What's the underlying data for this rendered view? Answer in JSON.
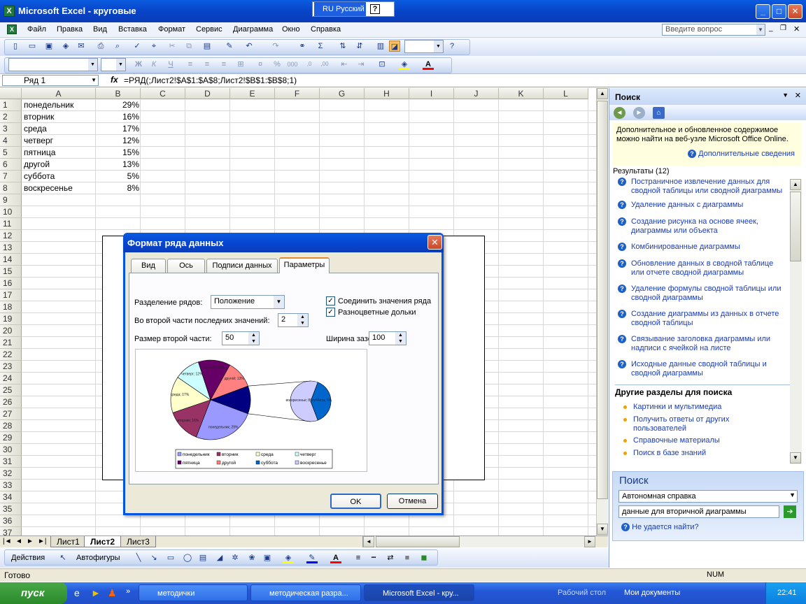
{
  "window": {
    "title": "Microsoft Excel - круговые",
    "lang": "RU Русский",
    "help_glyph": "?"
  },
  "menu": [
    "Файл",
    "Правка",
    "Вид",
    "Вставка",
    "Формат",
    "Сервис",
    "Диаграмма",
    "Окно",
    "Справка"
  ],
  "ask_placeholder": "Введите вопрос",
  "formula_bar": {
    "name_box": "Ряд 1",
    "fx": "fx",
    "formula": "=РЯД(;Лист2!$A$1:$A$8;Лист2!$B$1:$B$8;1)"
  },
  "columns": [
    "A",
    "B",
    "C",
    "D",
    "E",
    "F",
    "G",
    "H",
    "I",
    "J",
    "K",
    "L"
  ],
  "rows": [
    "1",
    "2",
    "3",
    "4",
    "5",
    "6",
    "7",
    "8",
    "9",
    "10",
    "11",
    "12",
    "13",
    "14",
    "15",
    "16",
    "17",
    "18",
    "19",
    "20",
    "21",
    "22",
    "23",
    "24",
    "25",
    "26",
    "27",
    "28",
    "29",
    "30",
    "31",
    "32",
    "33",
    "34",
    "35",
    "36",
    "37"
  ],
  "cells": [
    {
      "a": "понедельник",
      "b": "29%"
    },
    {
      "a": "вторник",
      "b": "16%"
    },
    {
      "a": "среда",
      "b": "17%"
    },
    {
      "a": "четверг",
      "b": "12%"
    },
    {
      "a": "пятница",
      "b": "15%"
    },
    {
      "a": "другой",
      "b": "13%"
    },
    {
      "a": "суббота",
      "b": "5%"
    },
    {
      "a": "воскресенье",
      "b": "8%"
    }
  ],
  "sheet_tabs": [
    "Лист1",
    "Лист2",
    "Лист3"
  ],
  "drawing_toolbar": {
    "actions": "Действия",
    "autoshapes": "Автофигуры"
  },
  "status": {
    "ready": "Готово",
    "num": "NUM"
  },
  "taskbar": {
    "start": "пуск",
    "tasks": [
      "методички",
      "методическая разра...",
      "Microsoft Excel - кру..."
    ],
    "desktop": "Рабочий стол",
    "my_docs": "Мои документы",
    "time": "22:41"
  },
  "task_pane": {
    "title": "Поиск",
    "info_text": "Дополнительное и обновленное содержимое можно найти на веб-узле Microsoft Office Online.",
    "info_link": "Дополнительные сведения",
    "results_label": "Результаты (12)",
    "results": [
      "Постраничное извлечение данных для сводной таблицы или сводной диаграммы",
      "Удаление данных с диаграммы",
      "Создание рисунка на основе ячеек, диаграммы или объекта",
      "Комбинированные диаграммы",
      "Обновление данных в сводной таблице или отчете сводной диаграммы",
      "Удаление формулы сводной таблицы или сводной диаграммы",
      "Создание диаграммы из данных в отчете сводной таблицы",
      "Связывание заголовка диаграммы или надписи с ячейкой на листе",
      "Исходные данные сводной таблицы и сводной диаграммы"
    ],
    "other_title": "Другие разделы для поиска",
    "other": [
      "Картинки и мультимедиа",
      "Получить ответы от других пользователей",
      "Справочные материалы",
      "Поиск в базе знаний"
    ],
    "search_title": "Поиск",
    "search_scope": "Автономная справка",
    "search_query": "данные для вторичной диаграммы",
    "not_found": "Не удается найти?"
  },
  "dialog": {
    "title": "Формат ряда данных",
    "tabs": [
      "Вид",
      "Ось",
      "Подписи данных",
      "Параметры"
    ],
    "split_label": "Разделение рядов:",
    "split_value": "Положение",
    "last_values_label": "Во второй части последних значений:",
    "last_values": "2",
    "size_label": "Размер второй части:",
    "size_value": "50",
    "gap_label": "Ширина зазора:",
    "gap_value": "100",
    "join_label": "Соединить значения ряда",
    "vary_label": "Разноцветные дольки",
    "join_checked": true,
    "vary_checked": true,
    "ok": "OK",
    "cancel": "Отмена"
  },
  "chart_data": {
    "type": "pie",
    "subtype": "pie-of-pie",
    "categories": [
      "понедельник",
      "вторник",
      "среда",
      "четверг",
      "пятница",
      "другой",
      "суббота",
      "воскресенье"
    ],
    "values": [
      29,
      16,
      17,
      12,
      15,
      13,
      5,
      8
    ],
    "primary_slices": [
      {
        "label": "понедельник; 29%",
        "value": 29,
        "color": "#9999ff"
      },
      {
        "label": "вторник; 16%",
        "value": 16,
        "color": "#993366"
      },
      {
        "label": "среда; 17%",
        "value": 17,
        "color": "#ffffcc"
      },
      {
        "label": "четверг; 12%",
        "value": 12,
        "color": "#ccffff"
      },
      {
        "label": "пятница; 15%",
        "value": 15,
        "color": "#660066"
      },
      {
        "label": "другой; 13%",
        "value": 13,
        "color": "#ff8080"
      },
      {
        "label": "",
        "value": 13,
        "color": "#000080"
      }
    ],
    "secondary_slices": [
      {
        "label": "воскресенье; 8%",
        "value": 8,
        "color": "#ccccff"
      },
      {
        "label": "суббота; 5%",
        "value": 5,
        "color": "#0066cc"
      }
    ],
    "legend": [
      {
        "name": "понедельник",
        "color": "#9999ff"
      },
      {
        "name": "вторник",
        "color": "#993366"
      },
      {
        "name": "среда",
        "color": "#ffffcc"
      },
      {
        "name": "четверг",
        "color": "#ccffff"
      },
      {
        "name": "пятница",
        "color": "#660066"
      },
      {
        "name": "другой",
        "color": "#ff8080"
      },
      {
        "name": "суббота",
        "color": "#0066cc"
      },
      {
        "name": "воскресенье",
        "color": "#ccccff"
      }
    ],
    "legend_position": "bottom"
  }
}
